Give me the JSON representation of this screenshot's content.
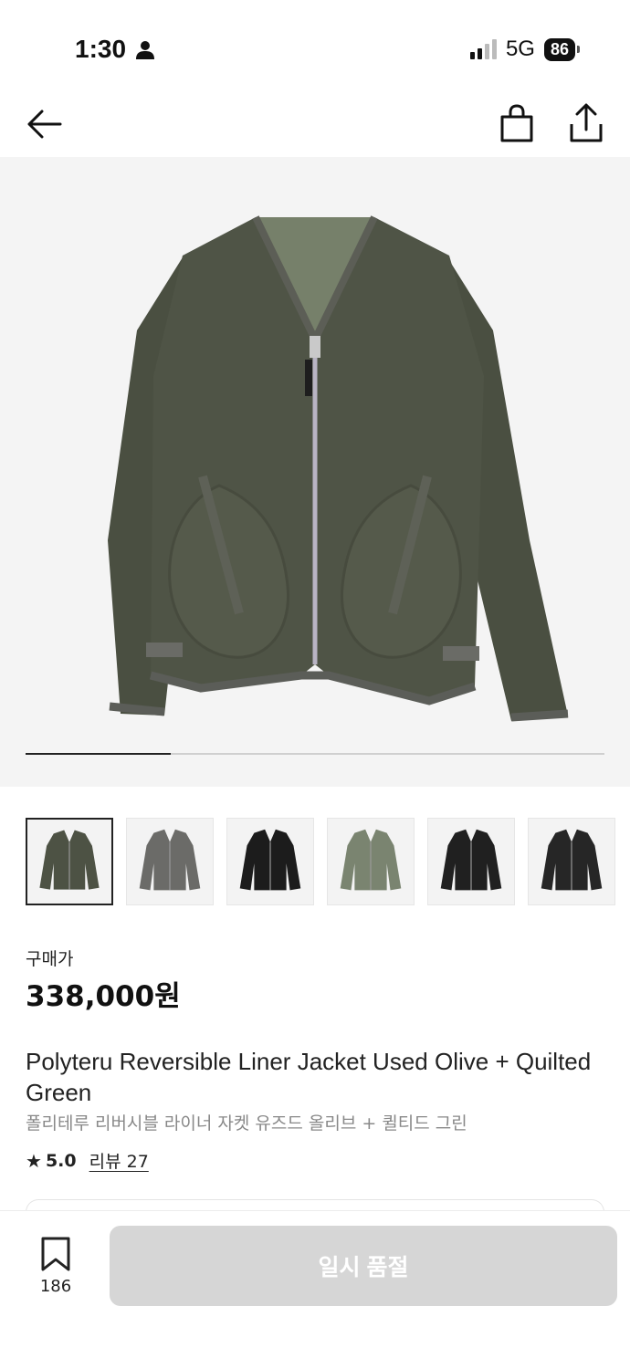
{
  "status_bar": {
    "time": "1:30",
    "network": "5G",
    "battery": "86",
    "icons": [
      "person-icon",
      "signal-icon"
    ]
  },
  "nav": {
    "icons": [
      "back-arrow-icon",
      "shopping-bag-icon",
      "share-icon"
    ]
  },
  "gallery": {
    "progress": 0.25,
    "thumbnails": [
      {
        "name": "olive",
        "color": "#4d5244",
        "active": true
      },
      {
        "name": "charcoal",
        "color": "#6b6b68",
        "active": false
      },
      {
        "name": "black",
        "color": "#1c1c1c",
        "active": false
      },
      {
        "name": "quilted-green",
        "color": "#7a8470",
        "active": false
      },
      {
        "name": "black-quilted",
        "color": "#202020",
        "active": false
      },
      {
        "name": "black-2",
        "color": "#262626",
        "active": false
      }
    ]
  },
  "product": {
    "price_label": "구매가",
    "price": "338,000원",
    "title_en": "Polyteru Reversible Liner Jacket Used Olive + Quilted Green",
    "title_ko": "폴리테루 리버시블 라이너 자켓 유즈드 올리브 + 퀼티드 그린",
    "rating": "5.0",
    "review_label": "리뷰 27"
  },
  "bottom_bar": {
    "wish_count": "186",
    "soldout_label": "일시 품절"
  },
  "colors": {
    "jacket_olive": "#4f5446",
    "disabled_button": "#d6d6d6"
  }
}
